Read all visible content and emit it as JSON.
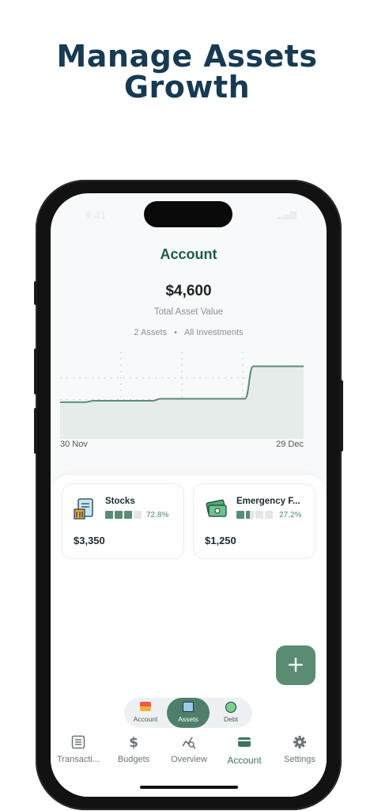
{
  "headline": {
    "line1": "Manage Assets",
    "line2": "Growth"
  },
  "status": {
    "time": "9:41"
  },
  "screen": {
    "title": "Account",
    "total_value": "$4,600",
    "total_label": "Total Asset Value",
    "meta_count": "2 Assets",
    "meta_separator": "•",
    "meta_filter": "All Investments",
    "x_start": "30 Nov",
    "x_end": "29 Dec"
  },
  "chart_data": {
    "type": "area",
    "x": [
      "30 Nov",
      "29 Dec"
    ],
    "series": [
      {
        "values": [
          3300,
          3300,
          3300,
          3300,
          3350,
          3350,
          3350,
          3350,
          3350,
          3350,
          3350,
          3350,
          3420,
          3420,
          3420,
          3420,
          3420,
          3420,
          3420,
          3420,
          3420,
          3420,
          3420,
          4600,
          4600,
          4600,
          4600,
          4600,
          4600,
          4600
        ]
      }
    ],
    "color": "#5a8c74",
    "grid": "dotted"
  },
  "assets": [
    {
      "name": "Stocks",
      "percent": "72.8%",
      "amount": "$3,350",
      "icon": "stocks-icon",
      "level": 0.728
    },
    {
      "name": "Emergency F...",
      "percent": "27.2%",
      "amount": "$1,250",
      "icon": "cash-icon",
      "level": 0.272
    }
  ],
  "subnav": {
    "items": [
      {
        "label": "Account",
        "icon": "wallet-icon"
      },
      {
        "label": "Assets",
        "icon": "assets-icon",
        "active": true
      },
      {
        "label": "Debt",
        "icon": "debt-icon"
      }
    ]
  },
  "tabs": [
    {
      "label": "Transacti...",
      "icon": "list-icon"
    },
    {
      "label": "Budgets",
      "icon": "dollar-icon"
    },
    {
      "label": "Overview",
      "icon": "chart-search-icon"
    },
    {
      "label": "Account",
      "icon": "card-icon",
      "active": true
    },
    {
      "label": "Settings",
      "icon": "gear-icon"
    }
  ],
  "colors": {
    "accent": "#5a8c74",
    "title": "#1f5a4b",
    "headline": "#173a52"
  }
}
